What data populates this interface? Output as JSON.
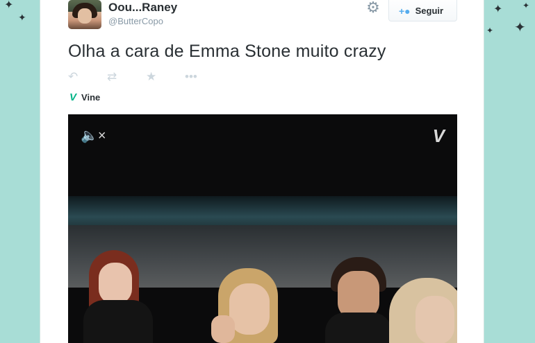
{
  "user": {
    "name": "Oou...Raney",
    "handle": "@ButterCopo"
  },
  "follow_button": {
    "label": "Seguir",
    "icon": "add-person-icon"
  },
  "settings": {
    "icon": "gear-icon"
  },
  "tweet": {
    "text": "Olha a cara de Emma Stone muito crazy"
  },
  "actions": [
    {
      "icon": "reply-icon"
    },
    {
      "icon": "retweet-icon"
    },
    {
      "icon": "favorite-star-icon"
    },
    {
      "icon": "more-icon"
    }
  ],
  "card_source": {
    "label": "Vine",
    "icon": "vine-icon"
  },
  "video": {
    "mute_icon": "muted-speaker-icon",
    "logo_icon": "vine-logo-icon"
  },
  "colors": {
    "background": "#a8ddd6",
    "accent": "#55acee",
    "vine": "#00b488"
  }
}
